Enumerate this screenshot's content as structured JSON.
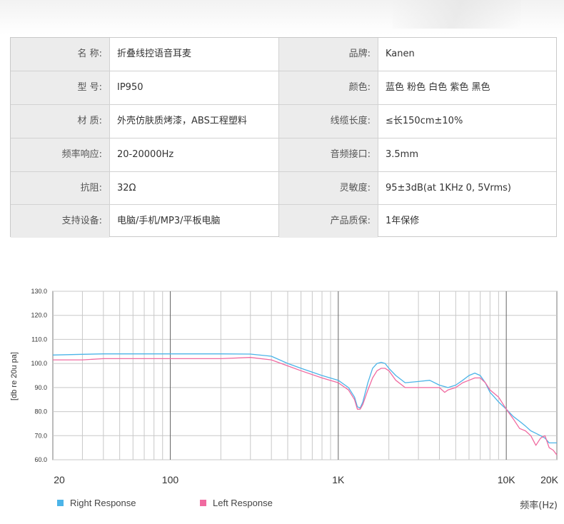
{
  "specs": {
    "rows": [
      {
        "label1": "名 称:",
        "value1": "折叠线控语音耳麦",
        "label2": "品牌:",
        "value2": "Kanen"
      },
      {
        "label1": "型 号:",
        "value1": "IP950",
        "label2": "颜色:",
        "value2": "蓝色 粉色 白色 紫色 黑色"
      },
      {
        "label1": "材 质:",
        "value1": "外壳仿肤质烤漆，ABS工程塑料",
        "label2": "线缆长度:",
        "value2": "≤长150cm±10%"
      },
      {
        "label1": "频率响应:",
        "value1": "20-20000Hz",
        "label2": "音频接口:",
        "value2": "3.5mm"
      },
      {
        "label1": "抗阻:",
        "value1": "32Ω",
        "label2": "灵敏度:",
        "value2": "95±3dB(at 1KHz 0, 5Vrms)"
      },
      {
        "label1": "支持设备:",
        "value1": "电脑/手机/MP3/平板电脑",
        "label2": "产品质保:",
        "value2": "1年保修"
      }
    ]
  },
  "chart_data": {
    "type": "line",
    "xscale": "log",
    "xlim": [
      20,
      20000
    ],
    "ylim": [
      60,
      130
    ],
    "ylabel": "[db re 20u pa]",
    "xunit_label": "频率(Hz)",
    "yticks": [
      "130.0",
      "120.0",
      "110.0",
      "100.0",
      "90.0",
      "80.0",
      "70.0",
      "60.0"
    ],
    "xticks": [
      {
        "value": 20,
        "label": "20"
      },
      {
        "value": 100,
        "label": "100"
      },
      {
        "value": 1000,
        "label": "1K"
      },
      {
        "value": 10000,
        "label": "10K"
      },
      {
        "value": 20000,
        "label": "20K"
      }
    ],
    "grid": true,
    "legend_position": "bottom",
    "series": [
      {
        "name": "Right Response",
        "color": "#4cb4e8",
        "x": [
          20,
          30,
          40,
          60,
          100,
          150,
          200,
          300,
          400,
          500,
          600,
          800,
          1000,
          1150,
          1250,
          1300,
          1350,
          1400,
          1500,
          1600,
          1700,
          1800,
          1900,
          2000,
          2200,
          2500,
          3000,
          3500,
          4000,
          4500,
          5000,
          5500,
          6000,
          6500,
          7000,
          7500,
          8000,
          8500,
          9000,
          10000,
          11000,
          12000,
          13000,
          14000,
          15000,
          16000,
          17000,
          18000,
          19000,
          20000
        ],
        "y": [
          103.5,
          103.8,
          104,
          104,
          104,
          104,
          104,
          103.9,
          103,
          100,
          98,
          95,
          93,
          90,
          86,
          82,
          81.5,
          84,
          92,
          98,
          100,
          100.5,
          100,
          98,
          95,
          92,
          92.5,
          93,
          91,
          90,
          91,
          93,
          95,
          96,
          95,
          92,
          88,
          86,
          84,
          81,
          78,
          76,
          74,
          72,
          71,
          70,
          69,
          67,
          67,
          67
        ]
      },
      {
        "name": "Left Response",
        "color": "#f06aa0",
        "x": [
          20,
          30,
          40,
          60,
          100,
          150,
          200,
          300,
          400,
          500,
          600,
          800,
          1000,
          1150,
          1250,
          1300,
          1350,
          1400,
          1500,
          1600,
          1700,
          1800,
          1900,
          2000,
          2200,
          2500,
          3000,
          3500,
          4000,
          4300,
          4500,
          5000,
          5500,
          6000,
          6500,
          7000,
          7500,
          8000,
          9000,
          10000,
          11000,
          12000,
          13000,
          14000,
          15000,
          16000,
          17000,
          18000,
          19000,
          20000
        ],
        "y": [
          101.5,
          101.5,
          102,
          102,
          102,
          102,
          102,
          102.5,
          101.5,
          99,
          97,
          94,
          92,
          89,
          85,
          81,
          81,
          83,
          89,
          94,
          97,
          98,
          98,
          97,
          93,
          90,
          90,
          90,
          90,
          88,
          89,
          90,
          92,
          93,
          94,
          94,
          92,
          89,
          86,
          81,
          77,
          73,
          72,
          70,
          66,
          69,
          70,
          65,
          64,
          62
        ]
      }
    ]
  }
}
